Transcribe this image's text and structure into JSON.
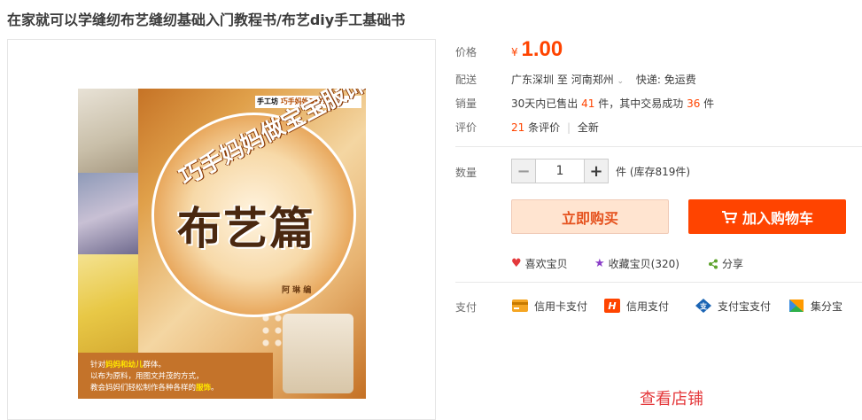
{
  "title": "在家就可以学缝纫布艺缝纫基础入门教程书/布艺diy手工基础书",
  "cover": {
    "series_brand": "手工坊",
    "series_name": "巧手妈妈DIY系列",
    "subtitle": "巧手妈妈做宝宝服饰",
    "main_title": "布艺篇",
    "author": "阿 琳 编",
    "blurb_line1_a": "针对",
    "blurb_line1_b": "妈妈和幼儿",
    "blurb_line1_c": "群体。",
    "blurb_line2": "以布为原料，用图文并茂的方式，",
    "blurb_line3_a": "教会妈妈们轻松制作各种各样的",
    "blurb_line3_b": "服饰",
    "blurb_line3_c": "。"
  },
  "price": {
    "label": "价格",
    "currency": "¥",
    "value": "1.00"
  },
  "delivery": {
    "label": "配送",
    "from": "广东深圳",
    "to_word": "至",
    "to": "河南郑州",
    "shipping": "快递: 免运费"
  },
  "sales": {
    "label": "销量",
    "prefix": "30天内已售出",
    "sold": "41",
    "mid": "件，其中交易成功",
    "success": "36",
    "suffix": "件"
  },
  "reviews": {
    "label": "评价",
    "count": "21",
    "count_suffix": "条评价",
    "sep": "|",
    "all": "全新"
  },
  "quantity": {
    "label": "数量",
    "minus": "−",
    "value": "1",
    "plus": "+",
    "stock": "件 (库存819件)"
  },
  "buttons": {
    "buy_now": "立即购买",
    "add_cart": "加入购物车"
  },
  "social": {
    "like": "喜欢宝贝",
    "favorite": "收藏宝贝(320)",
    "share": "分享"
  },
  "payment": {
    "label": "支付",
    "methods": [
      "信用卡支付",
      "信用支付",
      "支付宝支付",
      "集分宝"
    ]
  },
  "shop_link": "查看店铺"
}
